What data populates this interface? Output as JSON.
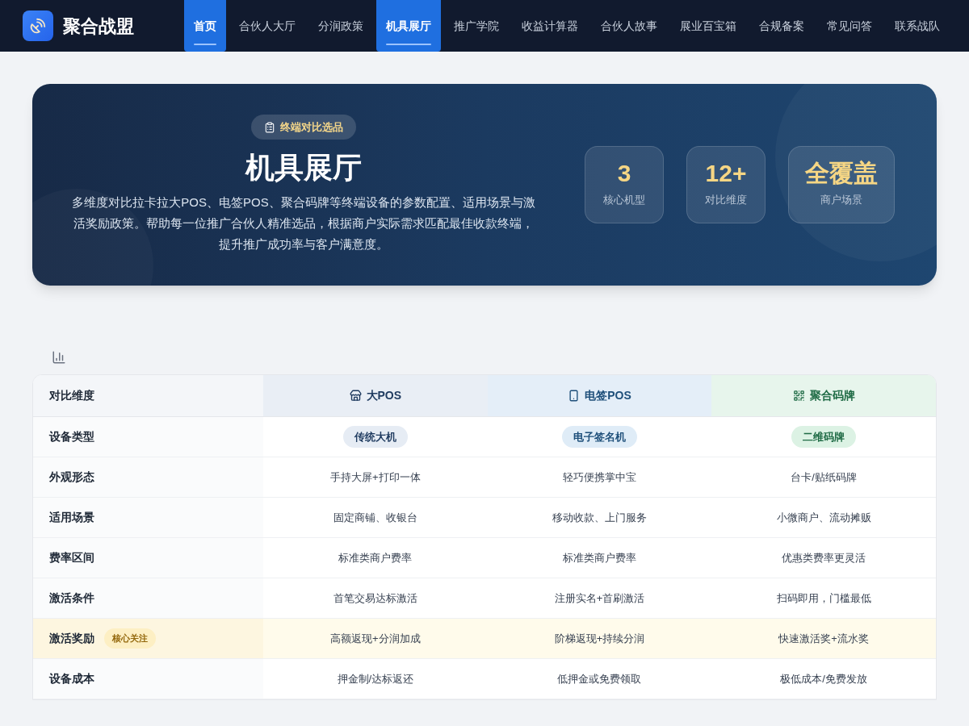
{
  "brand": {
    "name": "聚合战盟"
  },
  "nav": [
    {
      "label": "首页",
      "selected": true
    },
    {
      "label": "合伙人大厅",
      "selected": false
    },
    {
      "label": "分润政策",
      "selected": false
    },
    {
      "label": "机具展厅",
      "selected": true
    },
    {
      "label": "推广学院",
      "selected": false
    },
    {
      "label": "收益计算器",
      "selected": false
    },
    {
      "label": "合伙人故事",
      "selected": false
    },
    {
      "label": "展业百宝箱",
      "selected": false
    },
    {
      "label": "合规备案",
      "selected": false
    },
    {
      "label": "常见问答",
      "selected": false
    },
    {
      "label": "联系战队",
      "selected": false
    }
  ],
  "hero": {
    "badge": "终端对比选品",
    "title": "机具展厅",
    "description": "多维度对比拉卡拉大POS、电签POS、聚合码牌等终端设备的参数配置、适用场景与激活奖励政策。帮助每一位推广合伙人精准选品，根据商户实际需求匹配最佳收款终端，提升推广成功率与客户满意度。",
    "stats": [
      {
        "value": "3",
        "label": "核心机型"
      },
      {
        "value": "12+",
        "label": "对比维度"
      },
      {
        "value": "全覆盖",
        "label": "商户场景"
      }
    ]
  },
  "table": {
    "corner": "对比维度",
    "columns": [
      {
        "label": "大POS",
        "kind": "register",
        "color": "#1e3a5f"
      },
      {
        "label": "电签POS",
        "kind": "phone",
        "color": "#1e4f7a"
      },
      {
        "label": "聚合码牌",
        "kind": "qr",
        "color": "#1f6b45"
      }
    ],
    "rows": [
      {
        "label": "设备类型",
        "kind": "tag",
        "highlighted": false,
        "cells": [
          "传统大机",
          "电子签名机",
          "二维码牌"
        ]
      },
      {
        "label": "外观形态",
        "kind": "text",
        "highlighted": false,
        "cells": [
          "手持大屏+打印一体",
          "轻巧便携掌中宝",
          "台卡/贴纸码牌"
        ]
      },
      {
        "label": "适用场景",
        "kind": "text",
        "highlighted": false,
        "cells": [
          "固定商铺、收银台",
          "移动收款、上门服务",
          "小微商户、流动摊贩"
        ]
      },
      {
        "label": "费率区间",
        "kind": "text",
        "highlighted": false,
        "cells": [
          "标准类商户费率",
          "标准类商户费率",
          "优惠类费率更灵活"
        ]
      },
      {
        "label": "激活条件",
        "kind": "text",
        "highlighted": false,
        "cells": [
          "首笔交易达标激活",
          "注册实名+首刷激活",
          "扫码即用，门槛最低"
        ]
      },
      {
        "label": "激活奖励",
        "kind": "text",
        "highlighted": true,
        "badge": "核心关注",
        "cells": [
          "高额返现+分润加成",
          "阶梯返现+持续分润",
          "快速激活奖+流水奖"
        ]
      },
      {
        "label": "设备成本",
        "kind": "text",
        "highlighted": false,
        "cells": [
          "押金制/达标返还",
          "低押金或免费领取",
          "极低成本/免费发放"
        ]
      }
    ]
  }
}
